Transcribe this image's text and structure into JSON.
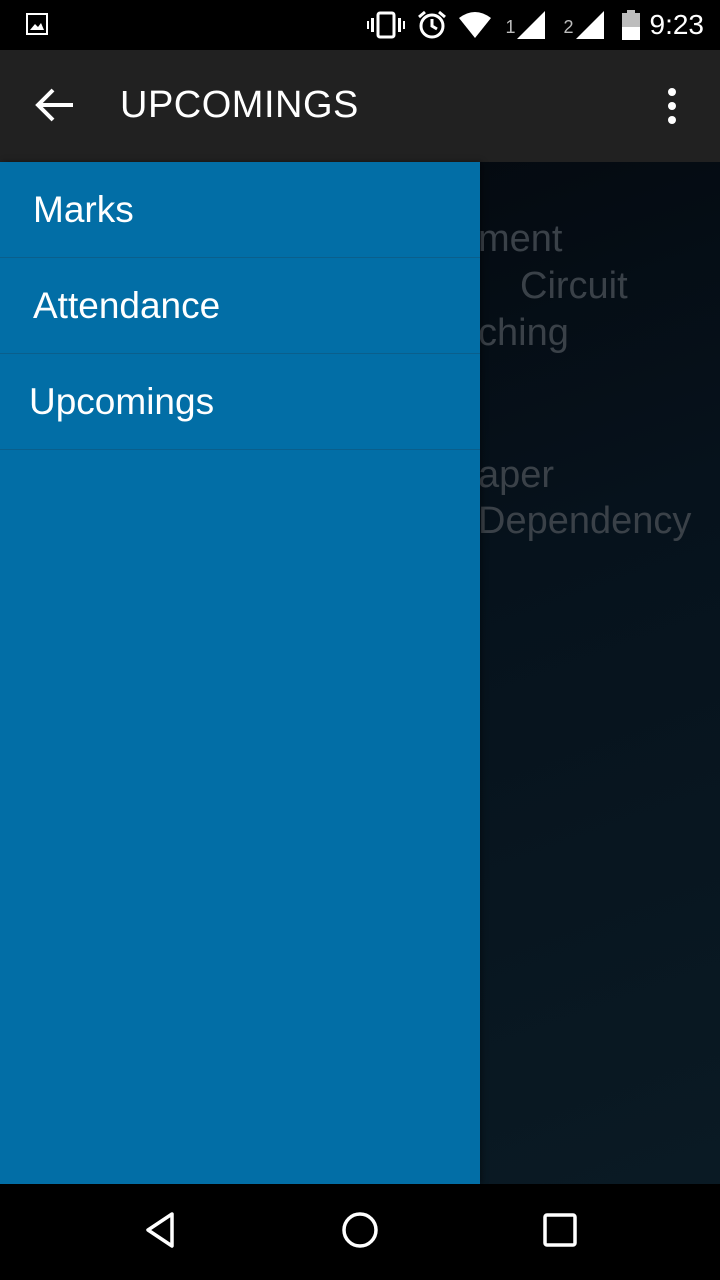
{
  "status_bar": {
    "time": "9:23",
    "sim1": "1",
    "sim2": "2",
    "icons": [
      "image-icon",
      "vibrate-icon",
      "alarm-icon",
      "wifi-icon",
      "signal-icon",
      "signal-icon",
      "battery-icon"
    ]
  },
  "app_bar": {
    "title": "UPCOMINGS",
    "back_icon": "arrow-back-icon",
    "overflow_icon": "more-vert-icon"
  },
  "drawer": {
    "items": [
      {
        "label": "Marks"
      },
      {
        "label": "Attendance"
      },
      {
        "label": "Upcomings"
      }
    ]
  },
  "background_content": {
    "fragments": [
      "ment",
      "Circuit",
      "ching",
      "aper",
      "Dependency"
    ]
  },
  "nav_bar": {
    "icons": [
      "back-triangle-icon",
      "home-circle-icon",
      "recents-square-icon"
    ]
  },
  "colors": {
    "drawer": "#026ea6",
    "app_bar": "#212121",
    "status_bar": "#000000"
  }
}
